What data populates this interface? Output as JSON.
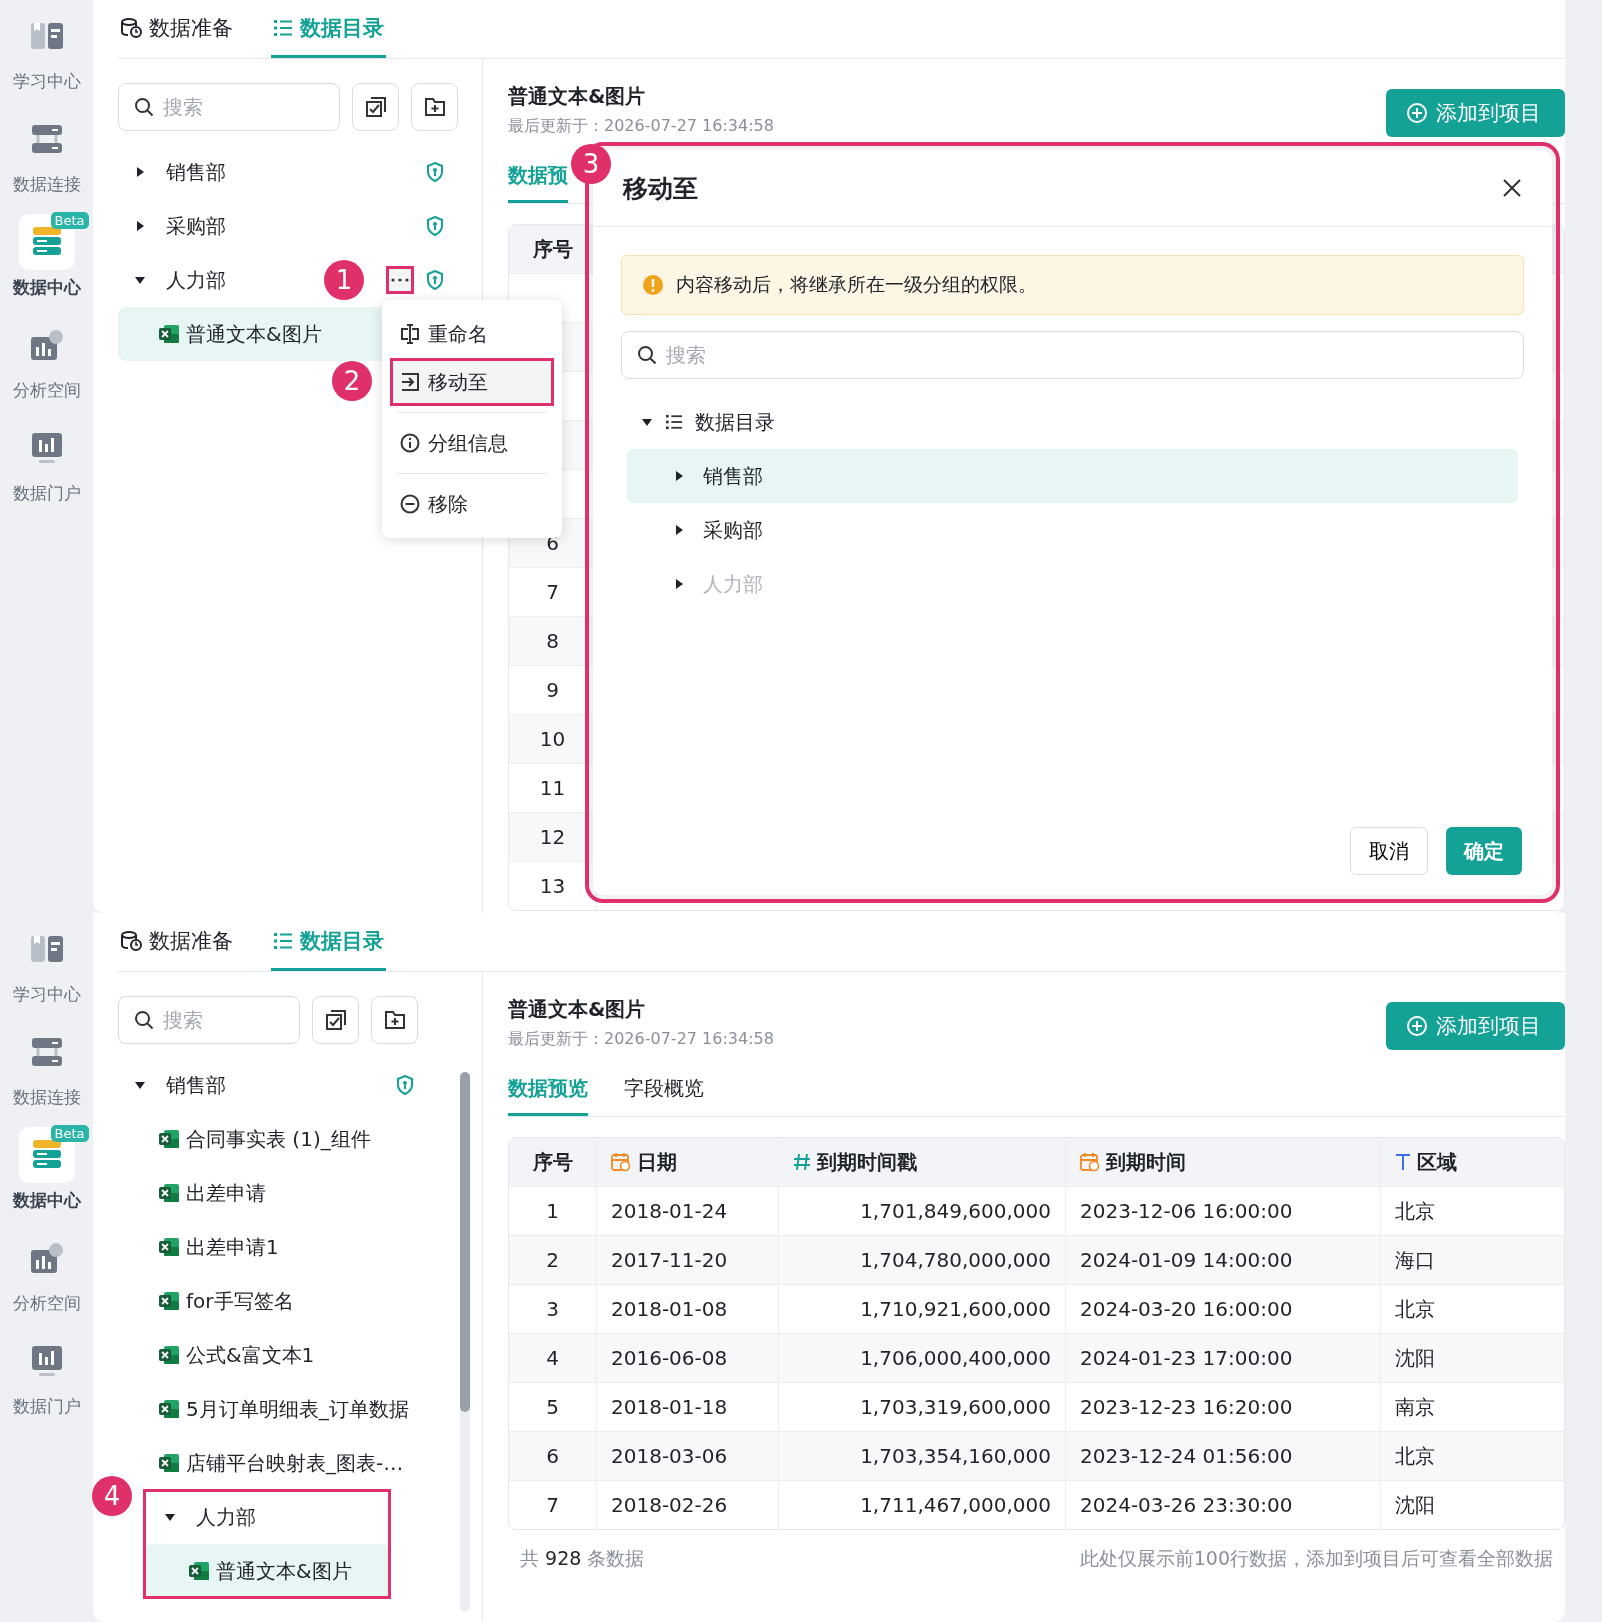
{
  "screens": [
    {
      "nav": [
        {
          "kind": "learn",
          "label": "学习中心",
          "selected": false
        },
        {
          "kind": "connect",
          "label": "数据连接",
          "selected": false
        },
        {
          "kind": "center",
          "label": "数据中心",
          "selected": true,
          "badge": "Beta"
        },
        {
          "kind": "analysis",
          "label": "分析空间",
          "selected": false
        },
        {
          "kind": "portal",
          "label": "数据门户",
          "selected": false
        }
      ],
      "tabs": [
        {
          "kind": "prep",
          "label": "数据准备",
          "selected": false
        },
        {
          "kind": "catalog",
          "label": "数据目录",
          "selected": true
        }
      ],
      "search": {
        "placeholder": "搜索"
      },
      "tree": [
        {
          "label": "销售部",
          "expanded": false,
          "shield": true
        },
        {
          "label": "采购部",
          "expanded": false,
          "shield": true
        },
        {
          "label": "人力部",
          "expanded": true,
          "shield": true,
          "more_button": {
            "callout": "1"
          },
          "children": [
            {
              "label": "普通文本&图片",
              "selected": true
            }
          ]
        }
      ],
      "detail": {
        "title": "普通文本&图片",
        "updated": "最后更新于：2026-07-27 16:34:58",
        "add_button": "添加到项目",
        "tabs": [
          {
            "label": "数据预",
            "selected": true
          }
        ],
        "columns": [
          {
            "kind": "index",
            "label": "序号"
          }
        ],
        "rows": [
          [
            "6"
          ],
          [
            "7"
          ],
          [
            "8"
          ],
          [
            "9"
          ],
          [
            "10"
          ],
          [
            "11"
          ],
          [
            "12"
          ],
          [
            "13"
          ]
        ]
      },
      "context_menu": {
        "items": [
          {
            "kind": "rename",
            "label": "重命名",
            "selected": false
          },
          {
            "kind": "move",
            "label": "移动至",
            "selected": true,
            "callout": "2"
          },
          {
            "kind": "info",
            "label": "分组信息",
            "selected": false
          },
          {
            "kind": "remove",
            "label": "移除",
            "selected": false
          }
        ]
      },
      "dialog": {
        "callout": "3",
        "title": "移动至",
        "alert": "内容移动后，将继承所在一级分组的权限。",
        "search_placeholder": "搜索",
        "tree": {
          "label": "数据目录",
          "expanded": true,
          "children": [
            {
              "label": "销售部",
              "selected": true,
              "disabled": false
            },
            {
              "label": "采购部",
              "selected": false,
              "disabled": false
            },
            {
              "label": "人力部",
              "selected": false,
              "disabled": true
            }
          ]
        },
        "cancel": "取消",
        "ok": "确定"
      }
    },
    {
      "nav": [
        {
          "kind": "learn",
          "label": "学习中心",
          "selected": false
        },
        {
          "kind": "connect",
          "label": "数据连接",
          "selected": false
        },
        {
          "kind": "center",
          "label": "数据中心",
          "selected": true,
          "badge": "Beta"
        },
        {
          "kind": "analysis",
          "label": "分析空间",
          "selected": false
        },
        {
          "kind": "portal",
          "label": "数据门户",
          "selected": false
        }
      ],
      "tabs": [
        {
          "kind": "prep",
          "label": "数据准备",
          "selected": false
        },
        {
          "kind": "catalog",
          "label": "数据目录",
          "selected": true
        }
      ],
      "search": {
        "placeholder": "搜索"
      },
      "tree": [
        {
          "label": "销售部",
          "expanded": true,
          "shield": true,
          "children": [
            {
              "label": "合同事实表 (1)_组件",
              "selected": false
            },
            {
              "label": "出差申请",
              "selected": false
            },
            {
              "label": "出差申请1",
              "selected": false
            },
            {
              "label": "for手写签名",
              "selected": false
            },
            {
              "label": "公式&富文本1",
              "selected": false
            },
            {
              "label": "5月订单明细表_订单数据",
              "selected": false
            },
            {
              "label": "店铺平台映射表_图表-…",
              "selected": false
            }
          ]
        },
        {
          "label": "人力部",
          "expanded": true,
          "shield": false,
          "callout": "4",
          "children": [
            {
              "label": "普通文本&图片",
              "selected": true
            }
          ]
        }
      ],
      "detail": {
        "title": "普通文本&图片",
        "updated": "最后更新于：2026-07-27 16:34:58",
        "add_button": "添加到项目",
        "tabs": [
          {
            "label": "数据预览",
            "selected": true
          },
          {
            "label": "字段概览",
            "selected": false
          }
        ],
        "columns": [
          {
            "kind": "index",
            "label": "序号"
          },
          {
            "kind": "date",
            "label": "日期"
          },
          {
            "kind": "number",
            "label": "到期时间戳"
          },
          {
            "kind": "date",
            "label": "到期时间"
          },
          {
            "kind": "text",
            "label": "区域"
          }
        ],
        "rows": [
          [
            "1",
            "2018-01-24",
            "1,701,849,600,000",
            "2023-12-06 16:00:00",
            "北京"
          ],
          [
            "2",
            "2017-11-20",
            "1,704,780,000,000",
            "2024-01-09 14:00:00",
            "海口"
          ],
          [
            "3",
            "2018-01-08",
            "1,710,921,600,000",
            "2024-03-20 16:00:00",
            "北京"
          ],
          [
            "4",
            "2016-06-08",
            "1,706,000,400,000",
            "2024-01-23 17:00:00",
            "沈阳"
          ],
          [
            "5",
            "2018-01-18",
            "1,703,319,600,000",
            "2023-12-23 16:20:00",
            "南京"
          ],
          [
            "6",
            "2018-03-06",
            "1,703,354,160,000",
            "2023-12-24 01:56:00",
            "北京"
          ],
          [
            "7",
            "2018-02-26",
            "1,711,467,000,000",
            "2024-03-26 23:30:00",
            "沈阳"
          ]
        ],
        "footer": {
          "prefix": "共",
          "count": "928",
          "suffix": "条数据",
          "note": "此处仅展示前100行数据，添加到项目后可查看全部数据"
        }
      }
    }
  ]
}
